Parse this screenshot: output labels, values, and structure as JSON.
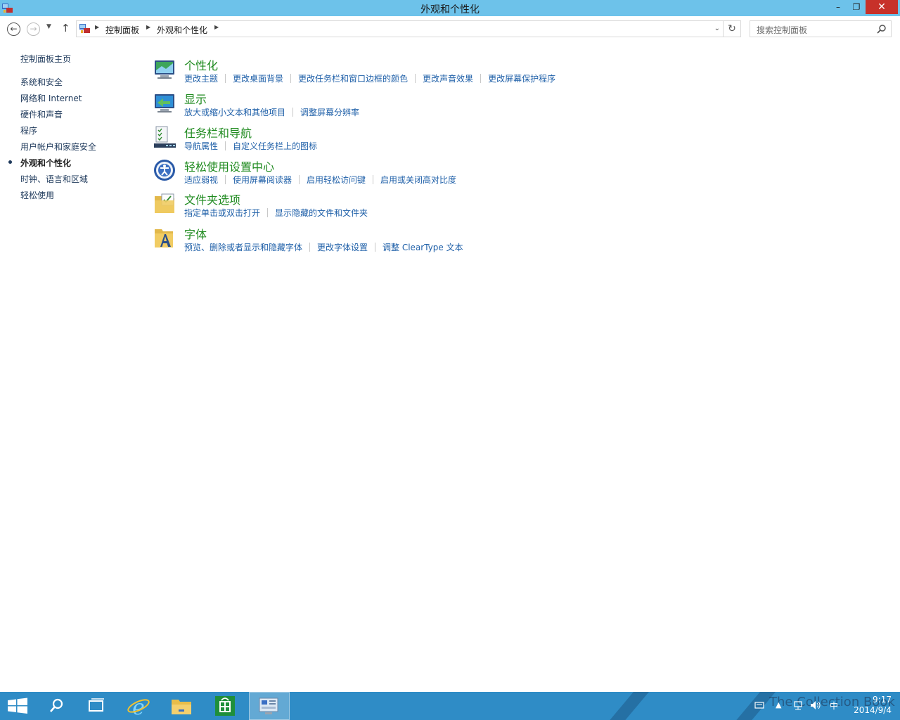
{
  "window": {
    "title": "外观和个性化",
    "minimize_glyph": "–",
    "maximize_glyph": "❐",
    "close_glyph": "✕"
  },
  "navbar": {
    "breadcrumbs": [
      "控制面板",
      "外观和个性化"
    ],
    "search_placeholder": "搜索控制面板"
  },
  "sidebar": {
    "items": [
      {
        "label": "控制面板主页",
        "current": false
      },
      {
        "label": "系统和安全",
        "current": false
      },
      {
        "label": "网络和 Internet",
        "current": false
      },
      {
        "label": "硬件和声音",
        "current": false
      },
      {
        "label": "程序",
        "current": false
      },
      {
        "label": "用户帐户和家庭安全",
        "current": false
      },
      {
        "label": "外观和个性化",
        "current": true
      },
      {
        "label": "时钟、语言和区域",
        "current": false
      },
      {
        "label": "轻松使用",
        "current": false
      }
    ]
  },
  "categories": [
    {
      "title": "个性化",
      "icon": "personalization-icon",
      "links": [
        "更改主题",
        "更改桌面背景",
        "更改任务栏和窗口边框的颜色",
        "更改声音效果",
        "更改屏幕保护程序"
      ]
    },
    {
      "title": "显示",
      "icon": "display-icon",
      "links": [
        "放大或缩小文本和其他项目",
        "调整屏幕分辨率"
      ]
    },
    {
      "title": "任务栏和导航",
      "icon": "taskbar-icon",
      "links": [
        "导航属性",
        "自定义任务栏上的图标"
      ]
    },
    {
      "title": "轻松使用设置中心",
      "icon": "ease-of-access-icon",
      "links": [
        "适应弱视",
        "使用屏幕阅读器",
        "启用轻松访问键",
        "启用或关闭高对比度"
      ]
    },
    {
      "title": "文件夹选项",
      "icon": "folder-options-icon",
      "links": [
        "指定单击或双击打开",
        "显示隐藏的文件和文件夹"
      ]
    },
    {
      "title": "字体",
      "icon": "fonts-icon",
      "links": [
        "预览、删除或者显示和隐藏字体",
        "更改字体设置",
        "调整 ClearType 文本"
      ]
    }
  ],
  "taskbar": {
    "items": [
      "start-icon",
      "search-icon",
      "task-view-icon",
      "internet-explorer-icon",
      "file-explorer-icon",
      "store-icon",
      "control-panel-icon"
    ],
    "ime": "中",
    "time": "9:17",
    "date": "2014/9/4",
    "watermark": "The Collection Book"
  },
  "colors": {
    "titlebar": "#6dc2ea",
    "category_title": "#1e8a1e",
    "link": "#1e5fa8",
    "taskbar": "#2f8cc6",
    "close_button": "#c7312a"
  }
}
